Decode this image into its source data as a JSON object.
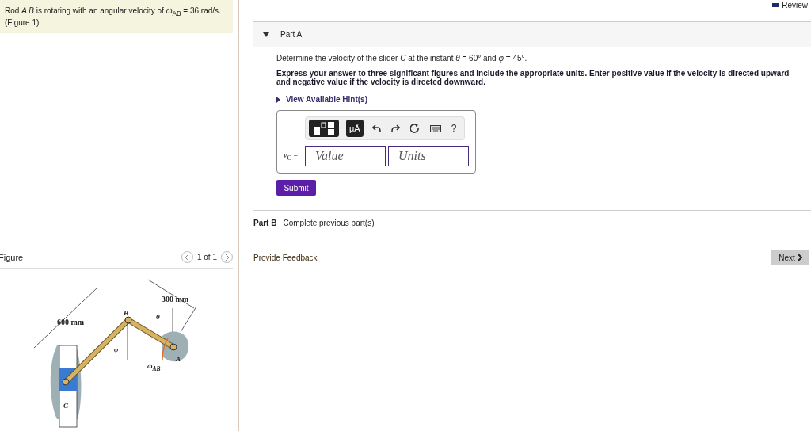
{
  "header": {
    "review": "Review"
  },
  "problem": {
    "text": "Rod *A B* is rotating with an angular velocity of *ω*$_{AB}$ = 36 rad/s.",
    "figure_link": "(Figure 1)"
  },
  "figure": {
    "title": "Figure",
    "pager": "1 of 1",
    "labels": [
      "600 mm",
      "300 mm",
      "B",
      "θ",
      "φ",
      "ω$_{AB}$",
      "A",
      "C"
    ]
  },
  "part_a": {
    "title": "Part A",
    "expanded": true,
    "question": "Determine the velocity of the slider *C* at the instant *θ* = 60° and *φ* = 45°.",
    "instructions": "Express your answer to three significant figures and include the appropriate units. Enter positive value if the velocity is directed upward and negative value if the velocity is  directed downward.",
    "hint": "View Available Hint(s)",
    "units_tool": "μÅ",
    "help": "?",
    "answer_label": "*v*$_{C}$ =",
    "value_placeholder": "Value",
    "units_placeholder": "Units",
    "submit": "Submit"
  },
  "part_b": {
    "title": "Part B",
    "status": "Complete previous part(s)"
  },
  "feedback": "Provide Feedback",
  "next": "Next"
}
